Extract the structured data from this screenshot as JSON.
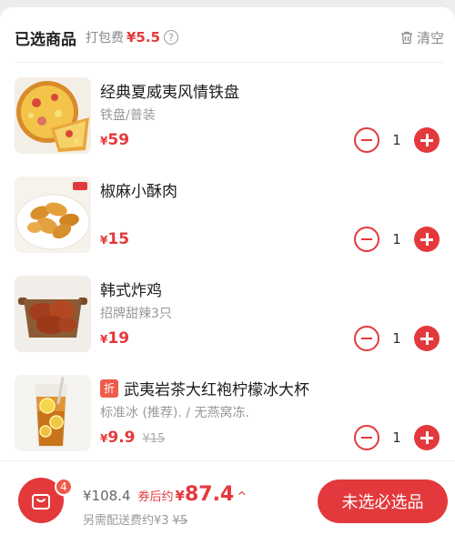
{
  "header": {
    "title": "已选商品",
    "packing_label": "打包费",
    "packing_fee": "¥5.5",
    "info_glyph": "?",
    "clear_label": "清空"
  },
  "items": [
    {
      "name": "经典夏威夷风情铁盘",
      "spec": "铁盘/普装",
      "currency": "¥",
      "price": "59",
      "old_price": "",
      "discount_tag": "",
      "qty": "1",
      "image": "pizza-image"
    },
    {
      "name": "椒麻小酥肉",
      "spec": "",
      "currency": "¥",
      "price": "15",
      "old_price": "",
      "discount_tag": "",
      "qty": "1",
      "image": "crispy-pork-image"
    },
    {
      "name": "韩式炸鸡",
      "spec": "招牌甜辣3只",
      "currency": "¥",
      "price": "19",
      "old_price": "",
      "discount_tag": "",
      "qty": "1",
      "image": "fried-chicken-image"
    },
    {
      "name": "武夷岩茶大红袍柠檬冰大杯",
      "spec": "标准冰 (推荐). / 无燕窝冻.",
      "currency": "¥",
      "price": "9.9",
      "old_price": "¥15",
      "discount_tag": "折",
      "qty": "1",
      "image": "lemon-tea-image"
    }
  ],
  "footer": {
    "cart_count": "4",
    "original_total": "¥108.4",
    "after_coupon_label": "券后约",
    "final_currency": "¥",
    "final_total": "87.4",
    "caret": "^",
    "delivery_label": "另需配送费约¥3",
    "delivery_original": "¥5",
    "submit_label": "未选必选品"
  },
  "colors": {
    "accent": "#e4393c",
    "muted": "#999999"
  }
}
